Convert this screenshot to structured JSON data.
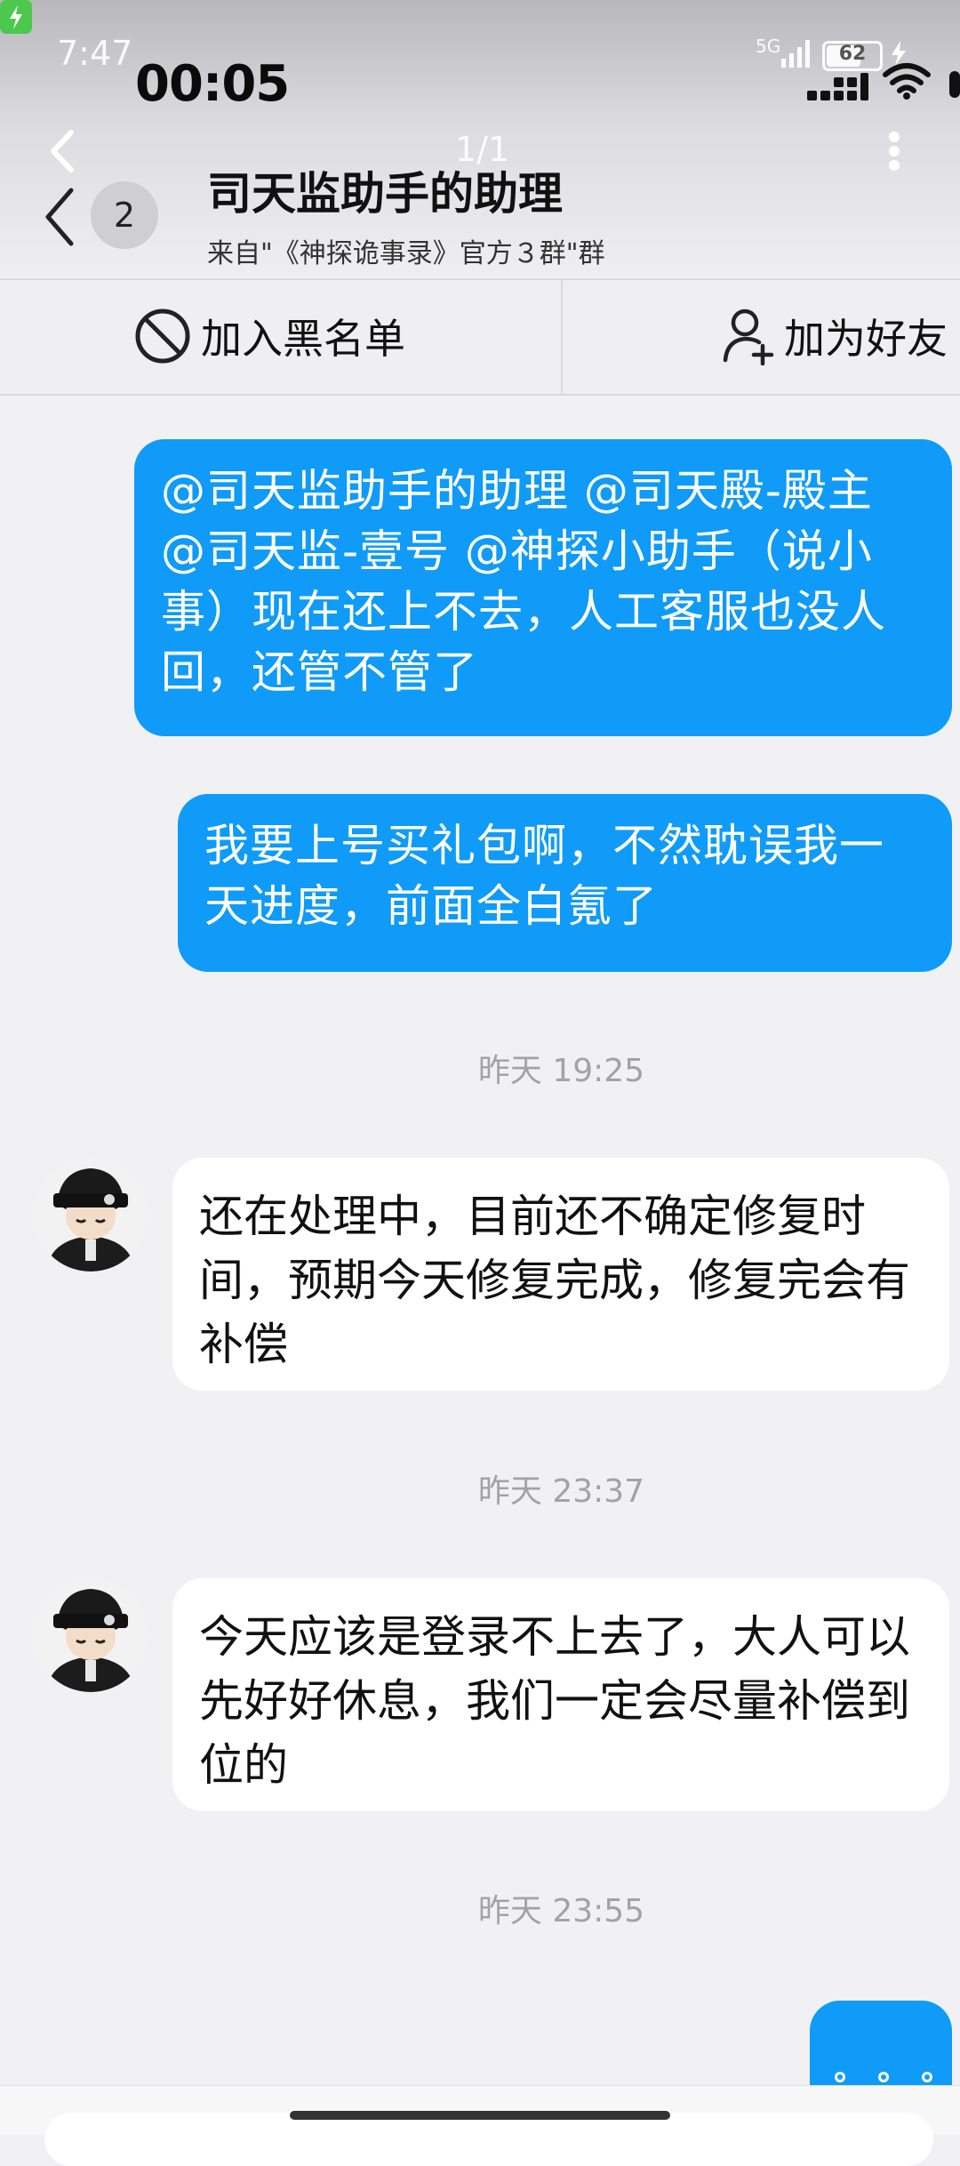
{
  "status_bar": {
    "time": "7:47",
    "network": "5G",
    "battery": "62"
  },
  "overlay": {
    "timer": "00:05",
    "page_counter": "1/1"
  },
  "header": {
    "unread_count": "2",
    "title": "司天监助手的助理",
    "subtitle": "来自\"《神探诡事录》官方３群\"群"
  },
  "actions": {
    "block_label": "加入黑名单",
    "add_friend_label": "加为好友"
  },
  "messages": [
    {
      "direction": "out",
      "text": "@司天监助手的助理 @司天殿-殿主 @司天监-壹号 @神探小助手（说小事）现在还上不去，人工客服也没人回，还管不管了"
    },
    {
      "direction": "out",
      "text": "我要上号买礼包啊，不然耽误我一天进度，前面全白氪了"
    },
    {
      "timestamp": "昨天 19:25"
    },
    {
      "direction": "in",
      "text": "还在处理中，目前还不确定修复时间，预期今天修复完成，修复完会有补偿"
    },
    {
      "timestamp": "昨天 23:37"
    },
    {
      "direction": "in",
      "text": "今天应该是登录不上去了，大人可以先好好休息，我们一定会尽量补偿到位的"
    },
    {
      "timestamp": "昨天 23:55"
    }
  ],
  "colors": {
    "outgoing_bubble": "#0f9bf7",
    "incoming_bubble": "#ffffff",
    "background": "#f1f1f3",
    "timestamp_text": "#a3a3a6"
  },
  "icons": [
    "back-icon",
    "more-icon",
    "block-icon",
    "add-user-icon",
    "signal-icon",
    "wifi-icon",
    "battery-icon",
    "charge-icon"
  ]
}
